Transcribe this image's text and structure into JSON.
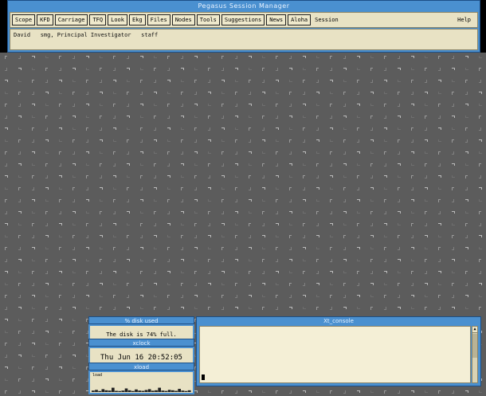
{
  "session": {
    "title": "Pegasus Session Manager",
    "menu": [
      "Scope",
      "KFD",
      "Carriage",
      "TFQ",
      "Look",
      "Ekg",
      "Files",
      "Nodes",
      "Tools",
      "Suggestions",
      "News",
      "Aloha"
    ],
    "session_label": "Session",
    "help_label": "Help",
    "status_text": "David   smg, Principal Investigator   staff"
  },
  "disk": {
    "title": "% disk used",
    "message": "The disk is 74% full."
  },
  "clock": {
    "title": "xclock",
    "time": "Thu Jun 16 20:52:05 1994"
  },
  "load": {
    "title": "xload",
    "label": "load",
    "samples": [
      0.1,
      0.15,
      0.05,
      0.2,
      0.12,
      0.1,
      0.3,
      0.08,
      0.05,
      0.1,
      0.25,
      0.12,
      0.06,
      0.18,
      0.1,
      0.08,
      0.14,
      0.2,
      0.09,
      0.12,
      0.3,
      0.1,
      0.07,
      0.15,
      0.12,
      0.08,
      0.22,
      0.1,
      0.06,
      0.12
    ]
  },
  "console": {
    "title": "Xt_console"
  },
  "colors": {
    "titlebar": "#4a90d0",
    "panel": "#e8e2c4",
    "desktop": "#000000"
  }
}
